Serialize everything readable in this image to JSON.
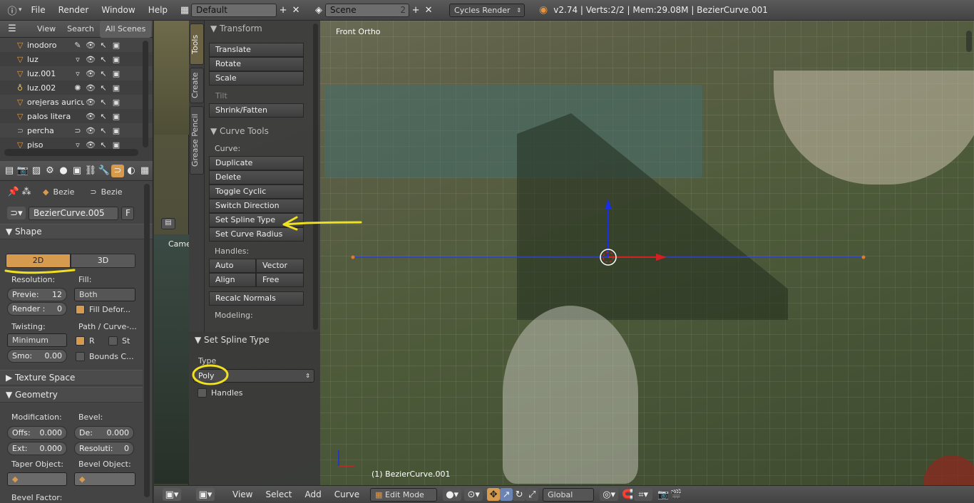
{
  "topbar": {
    "menus": [
      "File",
      "Render",
      "Window",
      "Help"
    ],
    "layout": "Default",
    "scene": "Scene",
    "scene_users": "2",
    "engine": "Cycles Render",
    "status": "v2.74 | Verts:2/2 | Mem:29.08M | BezierCurve.001"
  },
  "outliner": {
    "tabs": [
      "View",
      "Search",
      "All Scenes"
    ],
    "items": [
      {
        "name": "inodoro"
      },
      {
        "name": "luz"
      },
      {
        "name": "luz.001"
      },
      {
        "name": "luz.002"
      },
      {
        "name": "orejeras auricul"
      },
      {
        "name": "palos litera"
      },
      {
        "name": "percha"
      },
      {
        "name": "piso"
      }
    ]
  },
  "props": {
    "breadcrumb_a": "Bezie",
    "breadcrumb_b": "Bezie",
    "datablock": "BezierCurve.005",
    "fake_user": "F",
    "shape": {
      "title": "Shape",
      "mode_2d": "2D",
      "mode_3d": "3D",
      "resolution_label": "Resolution:",
      "fill_label": "Fill:",
      "preview": "Previe:",
      "preview_val": "12",
      "render": "Render :",
      "render_val": "0",
      "fill_value": "Both",
      "fill_deform": "Fill Defor...",
      "twisting_label": "Twisting:",
      "path_label": "Path / Curve-...",
      "twist_value": "Minimum",
      "r_label": "R",
      "st_label": "St",
      "smooth": "Smo:",
      "smooth_val": "0.00",
      "bounds": "Bounds C..."
    },
    "texture_space": "Texture Space",
    "geometry": {
      "title": "Geometry",
      "modification": "Modification:",
      "bevel": "Bevel:",
      "offset": "Offs:",
      "offset_val": "0.000",
      "depth": "De:",
      "depth_val": "0.000",
      "extrude": "Ext:",
      "extrude_val": "0.000",
      "resolution": "Resoluti:",
      "resolution_val": "0",
      "taper": "Taper Object:",
      "bevel_object": "Bevel Object:",
      "bevel_factor": "Bevel Factor:"
    }
  },
  "shelf": {
    "tabs": [
      "Tools",
      "Create",
      "Grease Pencil"
    ],
    "transform_title": "Transform",
    "transform": [
      "Translate",
      "Rotate",
      "Scale"
    ],
    "tilt": "Tilt",
    "shrink": "Shrink/Fatten",
    "curve_tools_title": "Curve Tools",
    "curve_label": "Curve:",
    "curve_buttons": [
      "Duplicate",
      "Delete",
      "Toggle Cyclic",
      "Switch Direction",
      "Set Spline Type",
      "Set Curve Radius"
    ],
    "handles_label": "Handles:",
    "handles": [
      "Auto",
      "Vector",
      "Align",
      "Free"
    ],
    "recalc": "Recalc Normals",
    "modeling": "Modeling:"
  },
  "redo": {
    "title": "Set Spline Type",
    "type_label": "Type",
    "type_value": "Poly",
    "handles": "Handles"
  },
  "viewport": {
    "view_name": "Front Ortho",
    "object_label": "(1) BezierCurve.001",
    "cam_label": "Came"
  },
  "bottombar": {
    "menus": [
      "View",
      "Select",
      "Add",
      "Curve"
    ],
    "mode": "Edit Mode",
    "orientation": "Global"
  },
  "colors": {
    "accent": "#d79b4f",
    "annotation": "#f0e020"
  }
}
